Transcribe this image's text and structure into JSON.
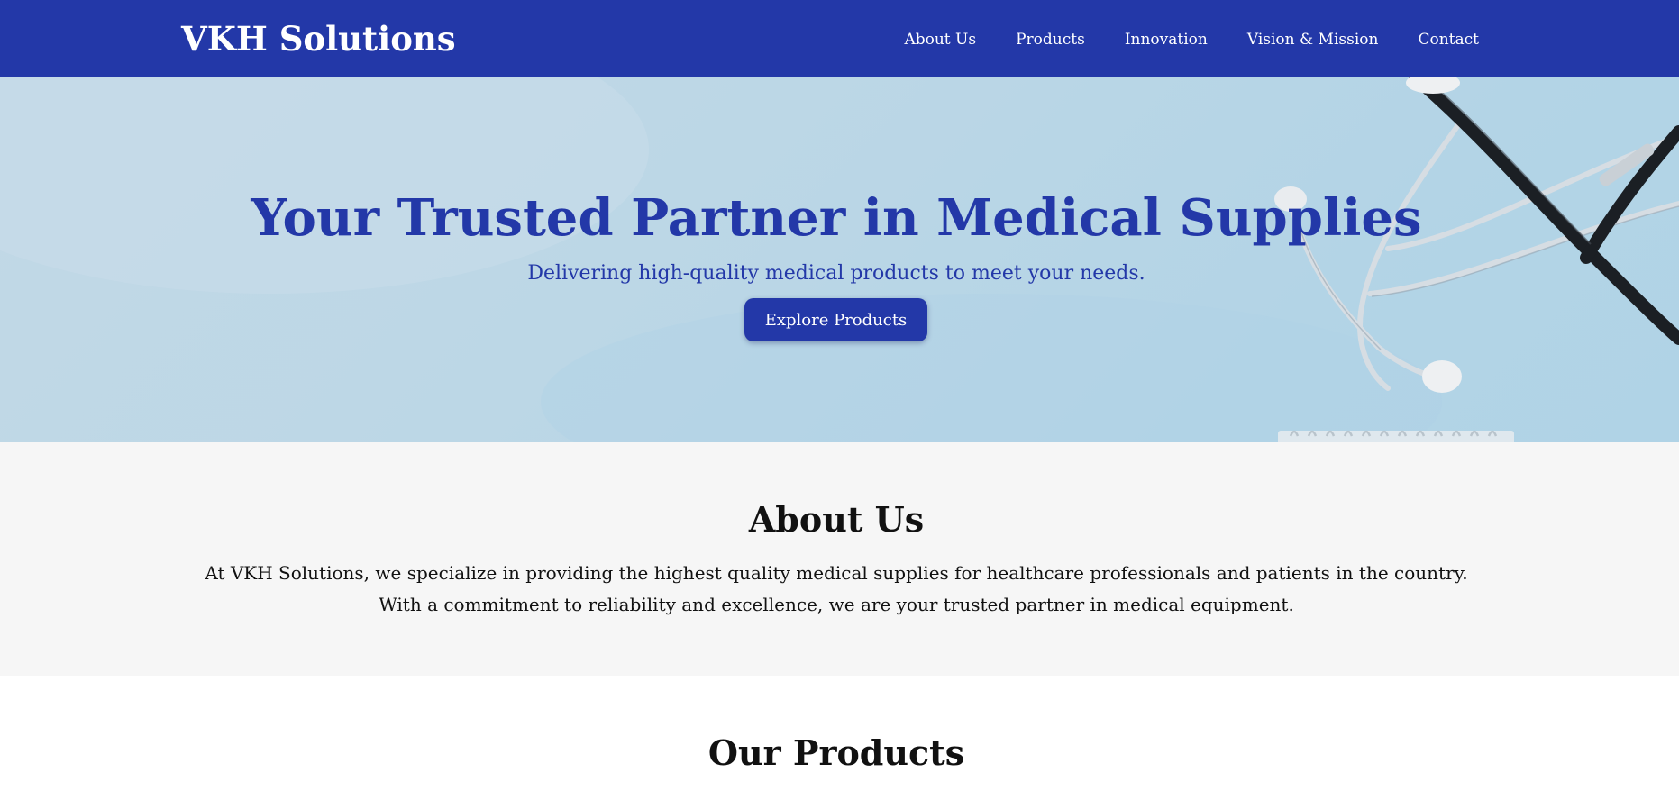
{
  "header": {
    "brand": "VKH Solutions",
    "nav": [
      "About Us",
      "Products",
      "Innovation",
      "Vision & Mission",
      "Contact"
    ]
  },
  "hero": {
    "title": "Your Trusted Partner in Medical Supplies",
    "subtitle": "Delivering high-quality medical products to meet your needs.",
    "cta": "Explore Products",
    "background_image": "stethoscope on light blue surface"
  },
  "about": {
    "heading": "About Us",
    "text": "At VKH Solutions, we specialize in providing the highest quality medical supplies for healthcare professionals and patients in the country. With a commitment to reliability and excellence, we are your trusted partner in medical equipment."
  },
  "products": {
    "heading": "Our Products"
  },
  "colors": {
    "brand_blue": "#2338a8",
    "hero_background": "#bcd7e6",
    "about_background": "#f6f6f6",
    "text_dark": "#111111"
  }
}
